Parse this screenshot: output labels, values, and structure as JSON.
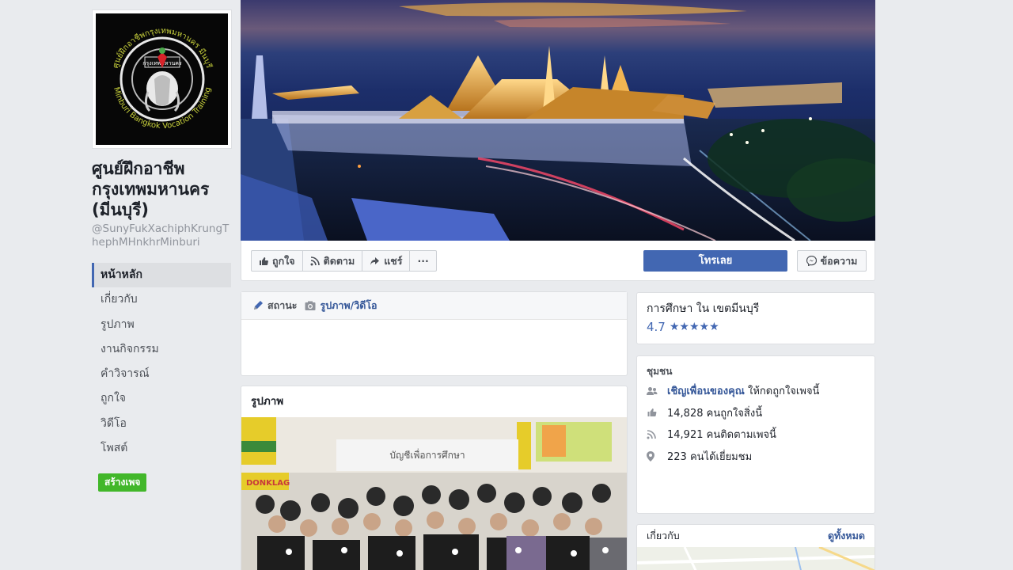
{
  "page": {
    "title": "ศูนย์ฝึกอาชีพกรุงเทพมหานคร (มีนบุรี)",
    "handle": "@SunyFukXachiphKrungThephMHnkhrMinburi",
    "logo_text_top": "ศูนย์ฝึกอาชีพกรุงเทพมหานคร มีนบุรี",
    "logo_text_bottom": "Minburi Bangkok Vocation Training",
    "logo_badge": "กรุงเทพมหานคร"
  },
  "nav": {
    "items": [
      {
        "label": "หน้าหลัก",
        "active": true
      },
      {
        "label": "เกี่ยวกับ"
      },
      {
        "label": "รูปภาพ"
      },
      {
        "label": "งานกิจกรรม"
      },
      {
        "label": "คำวิจารณ์"
      },
      {
        "label": "ถูกใจ"
      },
      {
        "label": "วิดีโอ"
      },
      {
        "label": "โพสต์"
      }
    ],
    "create_page_label": "สร้างเพจ"
  },
  "actions": {
    "like": "ถูกใจ",
    "follow": "ติดตาม",
    "share": "แชร์",
    "more": "···",
    "call": "โทรเลย",
    "message": "ข้อความ"
  },
  "composer": {
    "status_tab": "สถานะ",
    "photo_tab": "รูปภาพ/วิดีโอ"
  },
  "photos": {
    "title": "รูปภาพ",
    "sign_text": "บัญชีเพื่อการศึกษา",
    "banner_text": "DONKLAG"
  },
  "category": {
    "text": "การศึกษา ใน เขตมีนบุรี",
    "rating": "4.7",
    "stars": "★★★★★"
  },
  "community": {
    "title": "ชุมชน",
    "invite_link": "เชิญเพื่อนของคุณ",
    "invite_rest": " ให้กดถูกใจเพจนี้",
    "likes": "14,828 คนถูกใจสิ่งนี้",
    "follows": "14,921 คนติดตามเพจนี้",
    "visits": "223 คนได้เยี่ยมชม"
  },
  "about": {
    "title": "เกี่ยวกับ",
    "see_all": "ดูทั้งหมด"
  },
  "colors": {
    "fb_blue": "#4267b2",
    "link": "#365899",
    "green": "#42b72a",
    "bg": "#e9ebee"
  }
}
